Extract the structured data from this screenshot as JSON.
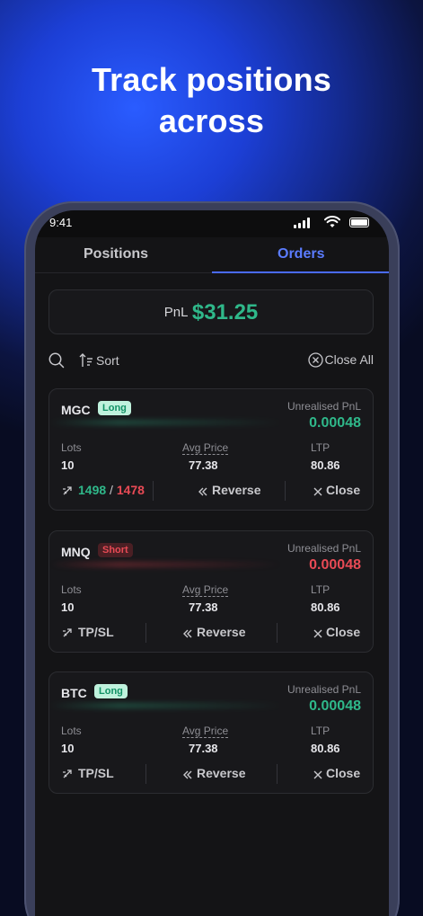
{
  "headline": {
    "line1": "Track positions",
    "line2": "across"
  },
  "status_bar": {
    "time": "9:41"
  },
  "tabs": [
    {
      "label": "Positions",
      "active": false
    },
    {
      "label": "Orders",
      "active": true
    }
  ],
  "pnl": {
    "label": "PnL",
    "value": "$31.25"
  },
  "toolbar": {
    "sort_label": "Sort",
    "close_all_label": "Close All"
  },
  "colors": {
    "accent": "#4a6bff",
    "profit": "#2fb88a",
    "loss": "#e84a55",
    "card_bg": "#18181b"
  },
  "cards": [
    {
      "symbol": "MGC",
      "side": "Long",
      "unrealised_label": "Unrealised PnL",
      "unrealised_value": "0.00048",
      "lots_label": "Lots",
      "lots": "10",
      "avg_label": "Avg Price",
      "avg": "77.38",
      "ltp_label": "LTP",
      "ltp": "80.86",
      "tp": "1498",
      "separator": "/",
      "sl": "1478",
      "reverse_label": "Reverse",
      "close_label": "Close"
    },
    {
      "symbol": "MNQ",
      "side": "Short",
      "unrealised_label": "Unrealised PnL",
      "unrealised_value": "0.00048",
      "lots_label": "Lots",
      "lots": "10",
      "avg_label": "Avg Price",
      "avg": "77.38",
      "ltp_label": "LTP",
      "ltp": "80.86",
      "tpsl_label": "TP/SL",
      "reverse_label": "Reverse",
      "close_label": "Close"
    },
    {
      "symbol": "BTC",
      "side": "Long",
      "unrealised_label": "Unrealised PnL",
      "unrealised_value": "0.00048",
      "lots_label": "Lots",
      "lots": "10",
      "avg_label": "Avg Price",
      "avg": "77.38",
      "ltp_label": "LTP",
      "ltp": "80.86",
      "tpsl_label": "TP/SL",
      "reverse_label": "Reverse",
      "close_label": "Close"
    }
  ]
}
